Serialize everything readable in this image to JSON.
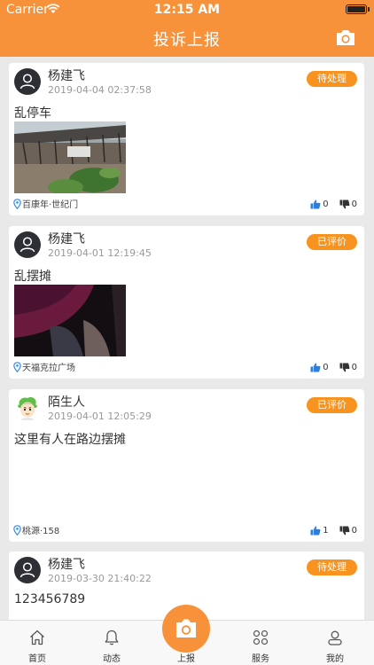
{
  "status_bar": {
    "carrier": "Carrier",
    "time": "12:15 AM"
  },
  "nav": {
    "title": "投诉上报"
  },
  "posts": [
    {
      "user": "杨建飞",
      "time": "2019-04-04 02:37:58",
      "status": "待处理",
      "content": "乱停车",
      "location": "百康年·世纪门",
      "likes": "0",
      "dislikes": "0"
    },
    {
      "user": "杨建飞",
      "time": "2019-04-01 12:19:45",
      "status": "已评价",
      "content": "乱摆摊",
      "location": "天福克拉广场",
      "likes": "0",
      "dislikes": "0"
    },
    {
      "user": "陌生人",
      "time": "2019-04-01 12:05:29",
      "status": "已评价",
      "content": "这里有人在路边摆摊",
      "location": "桃源·158",
      "likes": "1",
      "dislikes": "0"
    },
    {
      "user": "杨建飞",
      "time": "2019-03-30 21:40:22",
      "status": "待处理",
      "content": "123456789"
    }
  ],
  "tabs": [
    {
      "label": "首页",
      "icon": "home-icon"
    },
    {
      "label": "动态",
      "icon": "bell-icon"
    },
    {
      "label": "上报",
      "icon": "camera-icon"
    },
    {
      "label": "服务",
      "icon": "services-grid-icon"
    },
    {
      "label": "我的",
      "icon": "profile-icon"
    }
  ],
  "colors": {
    "accent": "#f7913a",
    "badge": "#f7931e",
    "like": "#2f7fd8"
  }
}
